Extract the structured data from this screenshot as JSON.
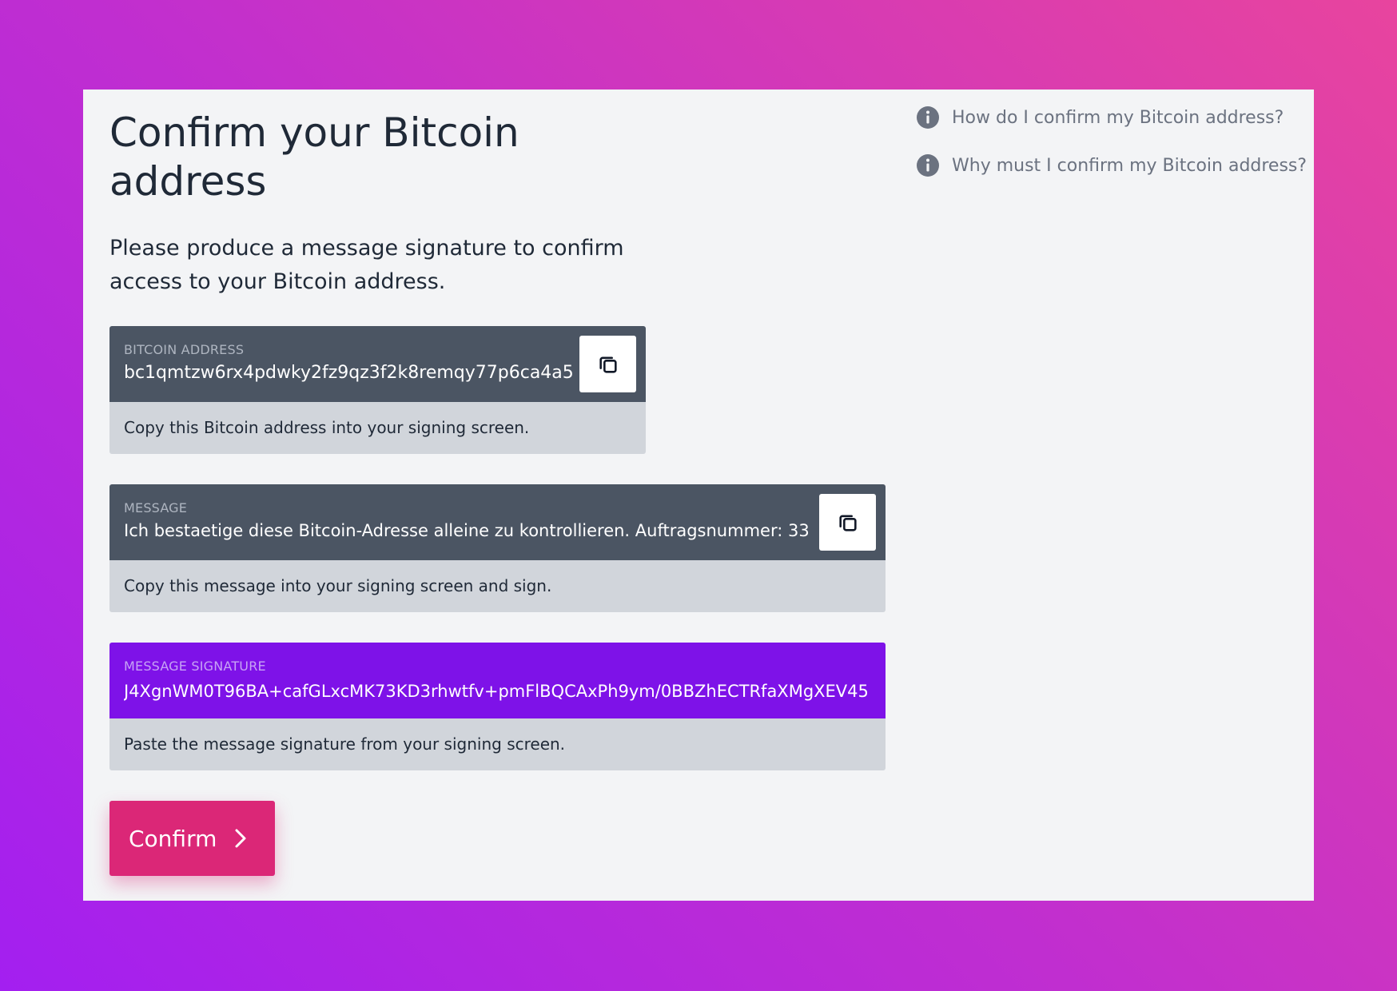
{
  "page": {
    "title": "Confirm your Bitcoin address",
    "intro": "Please produce a message signature to confirm access to your Bitcoin address."
  },
  "address": {
    "label": "BITCOIN ADDRESS",
    "value": "bc1qmtzw6rx4pdwky2fz9qz3f2k8remqy77p6ca4a5",
    "hint": "Copy this Bitcoin address into your signing screen.",
    "copy_icon": "copy-icon"
  },
  "message": {
    "label": "MESSAGE",
    "value": "Ich bestaetige diese Bitcoin-Adresse alleine zu kontrollieren. Auftragsnummer: 33",
    "hint": "Copy this message into your signing screen and sign.",
    "copy_icon": "copy-icon"
  },
  "signature": {
    "label": "MESSAGE SIGNATURE",
    "value": "J4XgnWM0T96BA+cafGLxcMK73KD3rhwtfv+pmFlBQCAxPh9ym/0BBZhECTRfaXMgXEV45",
    "hint": "Paste the message signature from your signing screen."
  },
  "confirm": {
    "label": "Confirm",
    "icon": "chevron-right-icon"
  },
  "help": [
    {
      "icon": "info-icon",
      "label": "How do I confirm my Bitcoin address?"
    },
    {
      "icon": "info-icon",
      "label": "Why must I confirm my Bitcoin address?"
    }
  ],
  "colors": {
    "background_start": "#a31ff0",
    "background_end": "#e8449e",
    "panel": "#f3f4f6",
    "field_dark": "#4b5563",
    "field_accent": "#7e12e8",
    "field_hint": "#d1d5db",
    "primary_button": "#db2777"
  }
}
